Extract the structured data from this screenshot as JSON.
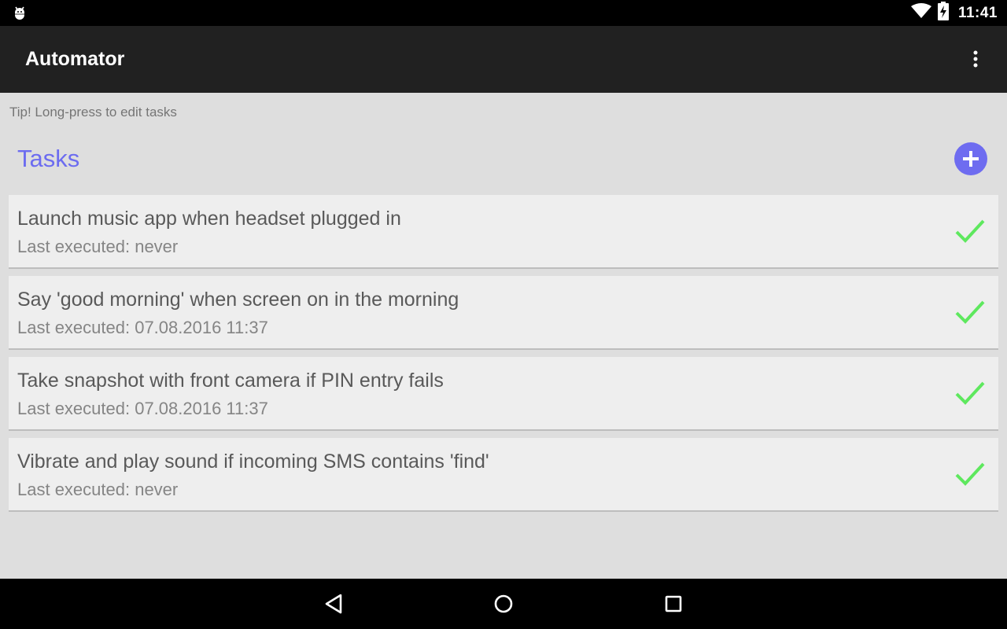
{
  "status_bar": {
    "time": "11:41",
    "icons": [
      "android-debug-icon",
      "wifi-icon",
      "battery-charging-icon"
    ]
  },
  "app_bar": {
    "title": "Automator",
    "overflow_icon": "more-vert-icon"
  },
  "tip": "Tip! Long-press to edit tasks",
  "section": {
    "title": "Tasks",
    "add_icon": "add-circle-icon"
  },
  "tasks": [
    {
      "title": "Launch music app when headset plugged in",
      "subtitle": "Last executed: never",
      "status_icon": "check-icon"
    },
    {
      "title": "Say 'good morning' when screen on in the morning",
      "subtitle": "Last executed: 07.08.2016 11:37",
      "status_icon": "check-icon"
    },
    {
      "title": "Take snapshot with front camera if PIN entry fails",
      "subtitle": "Last executed: 07.08.2016 11:37",
      "status_icon": "check-icon"
    },
    {
      "title": "Vibrate and play sound if incoming SMS contains 'find'",
      "subtitle": "Last executed: never",
      "status_icon": "check-icon"
    }
  ],
  "nav_bar": {
    "icons": [
      "back-icon",
      "home-icon",
      "recents-icon"
    ]
  },
  "colors": {
    "accent": "#6c6cf0",
    "check": "#5ee85e",
    "app_bar": "#212121",
    "background": "#dedede",
    "card": "#eeeeee"
  }
}
